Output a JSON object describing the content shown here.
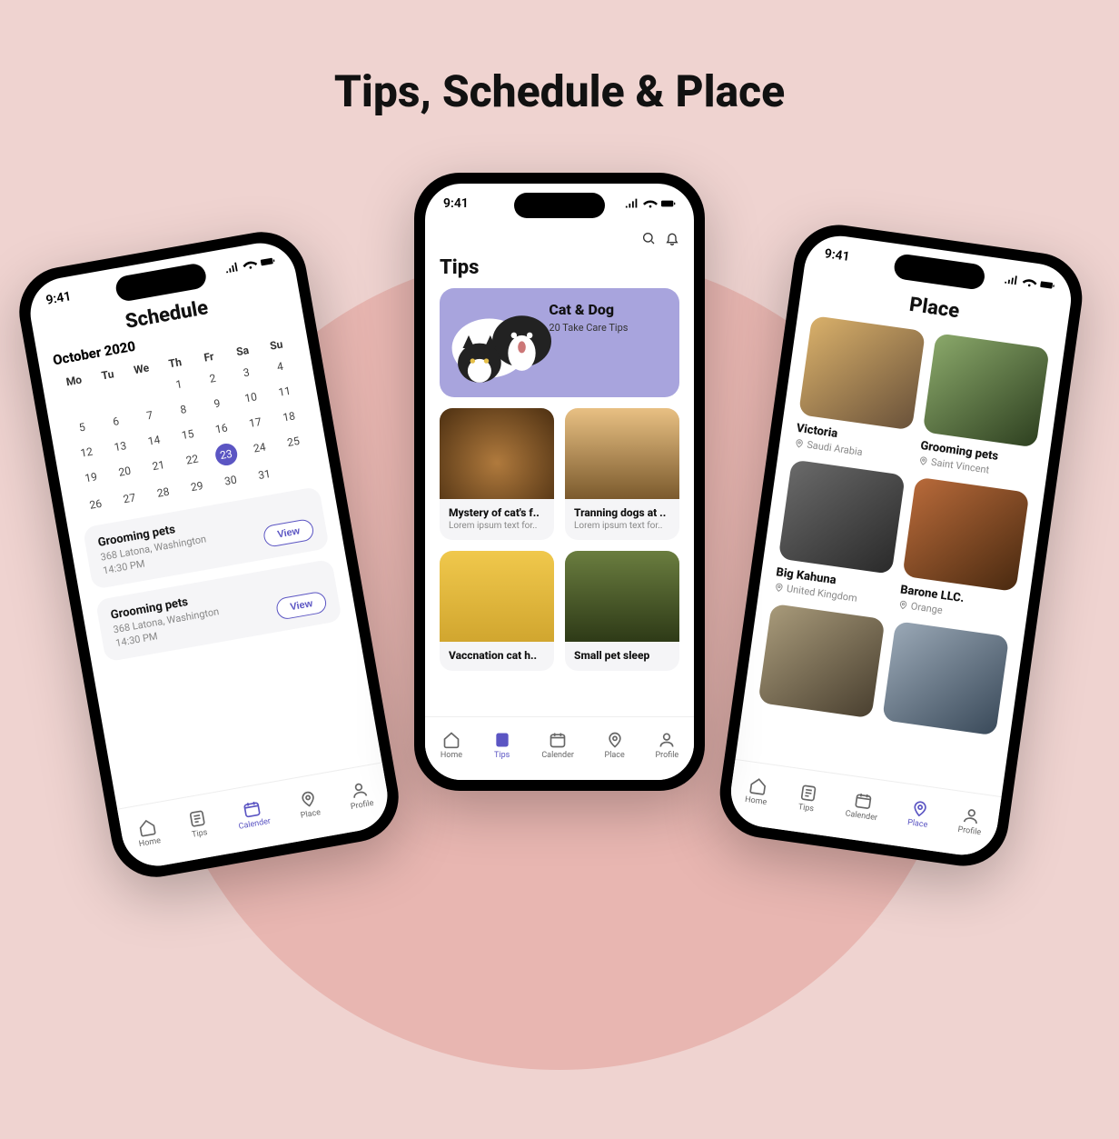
{
  "page_title": "Tips, Schedule & Place",
  "status_time": "9:41",
  "tabs": {
    "home": "Home",
    "tips": "Tips",
    "calender": "Calender",
    "place": "Place",
    "profile": "Profile"
  },
  "schedule": {
    "title": "Schedule",
    "month": "October 2020",
    "dow": [
      "Mo",
      "Tu",
      "We",
      "Th",
      "Fr",
      "Sa",
      "Su"
    ],
    "selected_day": 23,
    "events": [
      {
        "title": "Grooming pets",
        "address": "368 Latona, Washington",
        "time": "14:30 PM",
        "action": "View"
      },
      {
        "title": "Grooming pets",
        "address": "368 Latona, Washington",
        "time": "14:30 PM",
        "action": "View"
      }
    ]
  },
  "tips": {
    "title": "Tips",
    "hero": {
      "title": "Cat & Dog",
      "subtitle": "20 Take Care Tips"
    },
    "cards": [
      {
        "title": "Mystery of cat's f..",
        "subtitle": "Lorem ipsum text for.."
      },
      {
        "title": "Tranning dogs at ..",
        "subtitle": "Lorem ipsum text for.."
      },
      {
        "title": "Vaccnation cat h..",
        "subtitle": ""
      },
      {
        "title": "Small pet sleep",
        "subtitle": ""
      }
    ]
  },
  "place": {
    "title": "Place",
    "cards": [
      {
        "title": "Victoria",
        "location": "Saudi Arabia"
      },
      {
        "title": "Grooming pets",
        "location": "Saint Vincent"
      },
      {
        "title": "Big Kahuna",
        "location": "United Kingdom"
      },
      {
        "title": "Barone LLC.",
        "location": "Orange"
      }
    ]
  }
}
